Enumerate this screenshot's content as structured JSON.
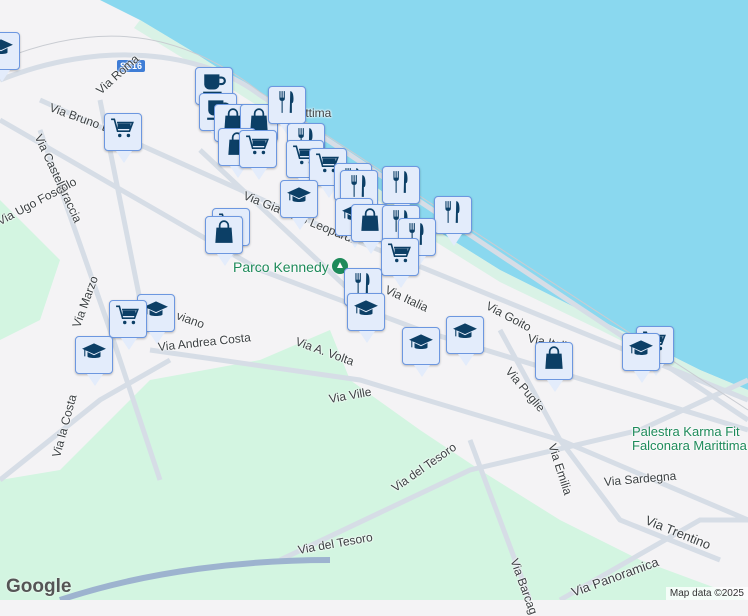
{
  "map": {
    "shield": "SS16",
    "labels": {
      "marittima": "Marittima",
      "via_roma": "Via Roma",
      "via_bruno": "Via Bruno B",
      "via_castellaraccia": "Via Castellaraccia",
      "via_ugo_foscolo": "Via Ugo Foscolo",
      "via_giacomo": "Via Giacomo Leopardi",
      "parco_kennedy": "Parco Kennedy",
      "via_italia_1": "Via Italia",
      "via_goito": "Via Goito",
      "via_italia_2": "Via Italia",
      "via_puglie": "Via Puglie",
      "via_a_volta": "Via A. Volta",
      "via_andrea_costa": "Via Andrea Costa",
      "via_ville": "Via Ville",
      "via_marzo": "Via Marzo",
      "via_la_costa": "Via la Costa",
      "via_del_tesoro_1": "Via del Tesoro",
      "via_del_tesoro_2": "Via del Tesoro",
      "via_emilia": "Via Emilia",
      "via_sardegna": "Via Sardegna",
      "via_trentino": "Via Trentino",
      "via_panoramica": "Via Panoramica",
      "via_barcaglione": "Via Barcag",
      "viano": "viano",
      "palestra_1": "Palestra Karma Fit",
      "palestra_2": "Falconara Marittima"
    },
    "markers": [
      "grad",
      "cafe",
      "cafe",
      "bag",
      "bag",
      "restaurant",
      "bag",
      "cart",
      "restaurant",
      "cart",
      "cart",
      "restaurant",
      "restaurant",
      "grad",
      "restaurant",
      "restaurant",
      "grad",
      "bag",
      "restaurant",
      "restaurant",
      "cart",
      "cart",
      "bag",
      "restaurant",
      "grad",
      "grad",
      "cart",
      "grad",
      "grad",
      "grad",
      "bag",
      "cart",
      "grad",
      "cart"
    ],
    "colors": {
      "sea": "#8ad8ef",
      "land": "#f4f3f5",
      "green": "#d3f5e1",
      "road": "#d6dde6",
      "marker": "#0c3f66"
    },
    "google": "Google",
    "attribution": "Map data ©2025"
  }
}
